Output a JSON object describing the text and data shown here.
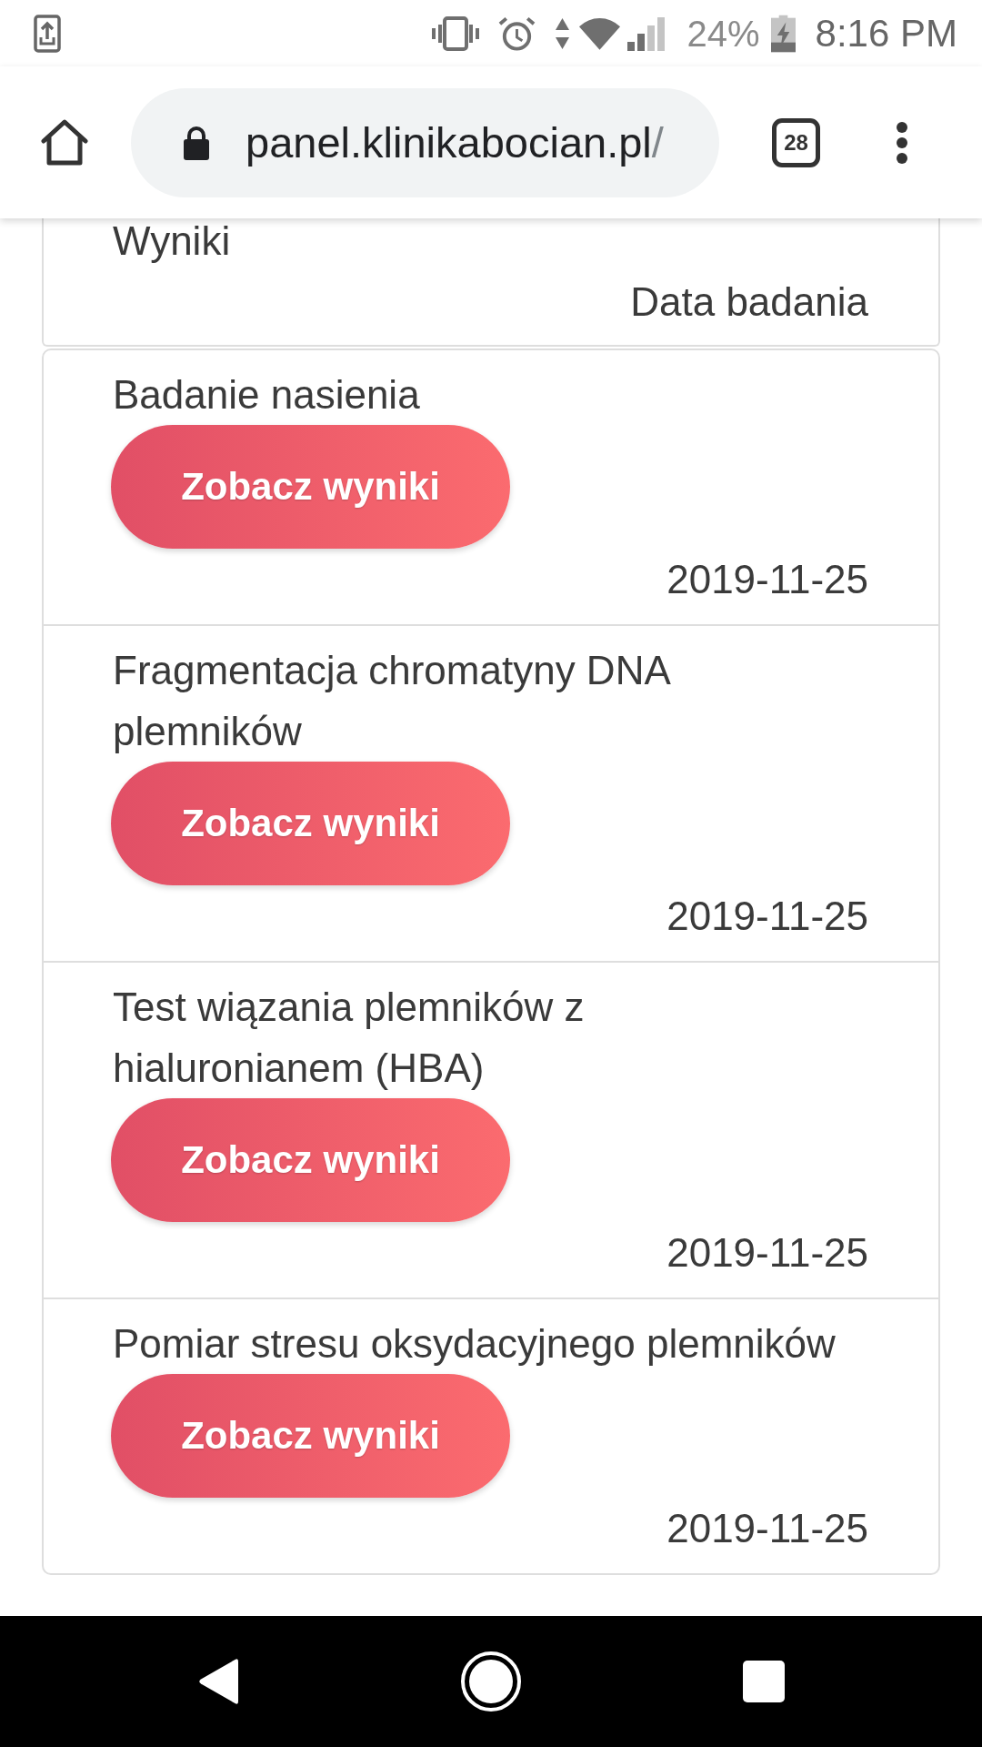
{
  "status_bar": {
    "battery": "24%",
    "time": "8:16 PM"
  },
  "browser": {
    "url": {
      "host": "panel.klinikabocian.pl",
      "path": "/"
    },
    "tab_count": "28"
  },
  "results": {
    "title": "Wyniki",
    "date_heading": "Data badania",
    "rows": [
      {
        "name": "Badanie nasienia",
        "action": "Zobacz wyniki",
        "date": "2019-11-25"
      },
      {
        "name": "Fragmentacja chromatyny DNA plemników",
        "action": "Zobacz wyniki",
        "date": "2019-11-25"
      },
      {
        "name": "Test wiązania plemników z hialuronianem (HBA)",
        "action": "Zobacz wyniki",
        "date": "2019-11-25"
      },
      {
        "name": "Pomiar stresu oksydacyjnego plemników",
        "action": "Zobacz wyniki",
        "date": "2019-11-25"
      }
    ]
  }
}
